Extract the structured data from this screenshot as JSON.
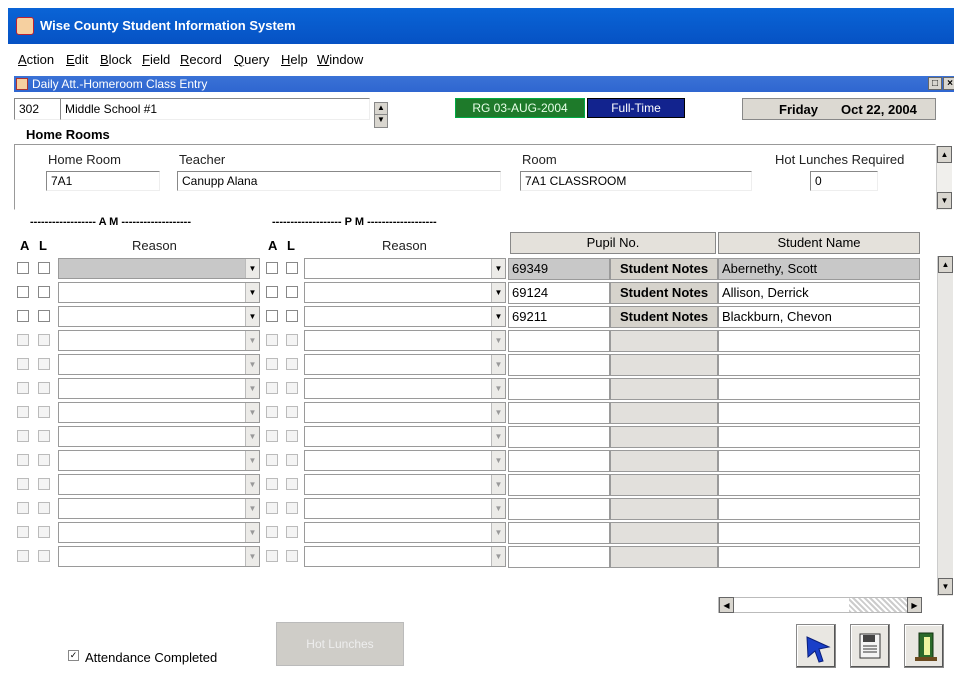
{
  "app_title": "Wise County Student Information System",
  "menu": [
    "Action",
    "Edit",
    "Block",
    "Field",
    "Record",
    "Query",
    "Help",
    "Window"
  ],
  "form": {
    "title": "Daily Att.-Homeroom Class Entry",
    "school_code": "302",
    "school_name": "Middle School #1",
    "status_badge": "RG 03-AUG-2004",
    "status_color": "#1e7a2a",
    "time_badge": "Full-Time",
    "time_color": "#12238e",
    "day": "Friday",
    "date": "Oct 22, 2004"
  },
  "home_rooms": {
    "section_label": "Home Rooms",
    "home_room_label": "Home Room",
    "home_room_value": "7A1",
    "teacher_label": "Teacher",
    "teacher_value": "Canupp Alana",
    "room_label": "Room",
    "room_value": "7A1 CLASSROOM",
    "hot_lunch_label": "Hot Lunches Required",
    "hot_lunch_value": "0"
  },
  "grid": {
    "am_label": "------------------ A  M -------------------",
    "pm_label": "------------------- P  M -------------------",
    "col_a": "A",
    "col_l": "L",
    "col_reason": "Reason",
    "col_pupil": "Pupil No.",
    "col_name": "Student Name",
    "notes_label": "Student Notes",
    "rows": [
      {
        "pupil": "69349",
        "notes": "Student Notes",
        "name": "Abernethy, Scott"
      },
      {
        "pupil": "69124",
        "notes": "Student Notes",
        "name": "Allison, Derrick"
      },
      {
        "pupil": "69211",
        "notes": "Student Notes",
        "name": "Blackburn, Chevon"
      },
      {
        "pupil": "",
        "notes": "",
        "name": ""
      },
      {
        "pupil": "",
        "notes": "",
        "name": ""
      },
      {
        "pupil": "",
        "notes": "",
        "name": ""
      },
      {
        "pupil": "",
        "notes": "",
        "name": ""
      },
      {
        "pupil": "",
        "notes": "",
        "name": ""
      },
      {
        "pupil": "",
        "notes": "",
        "name": ""
      },
      {
        "pupil": "",
        "notes": "",
        "name": ""
      },
      {
        "pupil": "",
        "notes": "",
        "name": ""
      },
      {
        "pupil": "",
        "notes": "",
        "name": ""
      },
      {
        "pupil": "",
        "notes": "",
        "name": ""
      }
    ]
  },
  "footer": {
    "attendance_completed": "Attendance Completed",
    "hot_lunches_button": "Hot Lunches"
  },
  "icons": {
    "app": "app-logo-icon",
    "navigate": "arrow-cursor-icon",
    "save": "save-floppy-icon",
    "exit": "exit-door-icon"
  }
}
